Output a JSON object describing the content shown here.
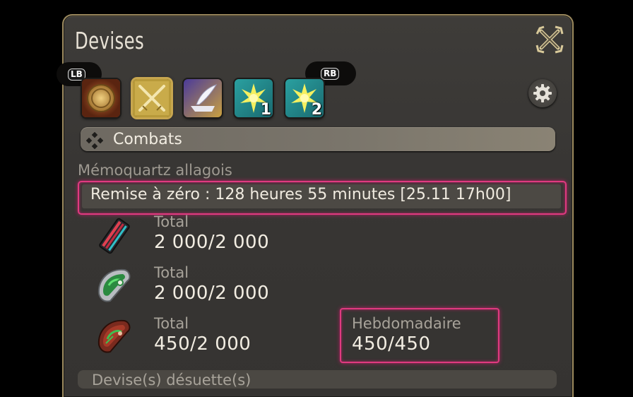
{
  "window": {
    "title": "Devises"
  },
  "tabs": {
    "lb_label": "LB",
    "rb_label": "RB",
    "items": [
      {
        "name": "coin-tab",
        "icon": "gil-coin-icon"
      },
      {
        "name": "combat-tab",
        "icon": "crossed-swords-icon",
        "selected": true
      },
      {
        "name": "crafting-tab",
        "icon": "quill-anvil-icon"
      },
      {
        "name": "tribe-tab-1",
        "icon": "crystal-star-icon",
        "badge": "1"
      },
      {
        "name": "tribe-tab-2",
        "icon": "crystal-star-icon",
        "badge": "2"
      }
    ]
  },
  "section": {
    "title": "Combats"
  },
  "subheading": "Mémoquartz allagois",
  "reset": {
    "text": "Remise à zéro : 128 heures 55 minutes [25.11 17h00]"
  },
  "currencies": [
    {
      "icon": "red-poetics-icon",
      "total_label": "Total",
      "total_value": "2 000/2 000"
    },
    {
      "icon": "green-tomestone-icon",
      "total_label": "Total",
      "total_value": "2 000/2 000"
    },
    {
      "icon": "red-tomestone-icon",
      "total_label": "Total",
      "total_value": "450/2 000",
      "weekly_label": "Hebdomadaire",
      "weekly_value": "450/450"
    }
  ],
  "obsolete_section": "Devise(s) désuette(s)",
  "colors": {
    "highlight": "#e03a80",
    "frame_gold": "#9c8a5e"
  }
}
